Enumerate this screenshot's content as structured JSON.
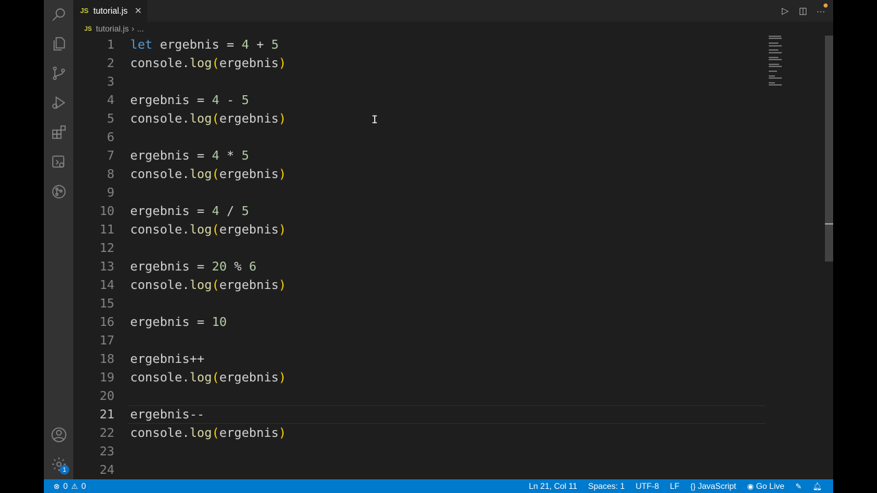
{
  "tab": {
    "label": "tutorial.js",
    "lang_badge": "JS"
  },
  "breadcrumb": {
    "file": "tutorial.js",
    "sep": "›",
    "more": "..."
  },
  "editor": {
    "lines": [
      {
        "n": "1",
        "tokens": [
          [
            "kw",
            "let"
          ],
          [
            "var",
            " ergebnis "
          ],
          [
            "op",
            "= "
          ],
          [
            "num",
            "4"
          ],
          [
            "op",
            " + "
          ],
          [
            "num",
            "5"
          ]
        ]
      },
      {
        "n": "2",
        "tokens": [
          [
            "var",
            "console."
          ],
          [
            "fn",
            "log"
          ],
          [
            "par",
            "("
          ],
          [
            "var",
            "ergebnis"
          ],
          [
            "par",
            ")"
          ]
        ]
      },
      {
        "n": "3",
        "tokens": []
      },
      {
        "n": "4",
        "tokens": [
          [
            "var",
            "ergebnis "
          ],
          [
            "op",
            "= "
          ],
          [
            "num",
            "4"
          ],
          [
            "op",
            " - "
          ],
          [
            "num",
            "5"
          ]
        ]
      },
      {
        "n": "5",
        "tokens": [
          [
            "var",
            "console."
          ],
          [
            "fn",
            "log"
          ],
          [
            "par",
            "("
          ],
          [
            "var",
            "ergebnis"
          ],
          [
            "par",
            ")"
          ]
        ]
      },
      {
        "n": "6",
        "tokens": []
      },
      {
        "n": "7",
        "tokens": [
          [
            "var",
            "ergebnis "
          ],
          [
            "op",
            "= "
          ],
          [
            "num",
            "4"
          ],
          [
            "op",
            " * "
          ],
          [
            "num",
            "5"
          ]
        ]
      },
      {
        "n": "8",
        "tokens": [
          [
            "var",
            "console."
          ],
          [
            "fn",
            "log"
          ],
          [
            "par",
            "("
          ],
          [
            "var",
            "ergebnis"
          ],
          [
            "par",
            ")"
          ]
        ]
      },
      {
        "n": "9",
        "tokens": []
      },
      {
        "n": "10",
        "tokens": [
          [
            "var",
            "ergebnis "
          ],
          [
            "op",
            "= "
          ],
          [
            "num",
            "4"
          ],
          [
            "op",
            " / "
          ],
          [
            "num",
            "5"
          ]
        ]
      },
      {
        "n": "11",
        "tokens": [
          [
            "var",
            "console."
          ],
          [
            "fn",
            "log"
          ],
          [
            "par",
            "("
          ],
          [
            "var",
            "ergebnis"
          ],
          [
            "par",
            ")"
          ]
        ]
      },
      {
        "n": "12",
        "tokens": []
      },
      {
        "n": "13",
        "tokens": [
          [
            "var",
            "ergebnis "
          ],
          [
            "op",
            "= "
          ],
          [
            "num",
            "20"
          ],
          [
            "op",
            " % "
          ],
          [
            "num",
            "6"
          ]
        ]
      },
      {
        "n": "14",
        "tokens": [
          [
            "var",
            "console."
          ],
          [
            "fn",
            "log"
          ],
          [
            "par",
            "("
          ],
          [
            "var",
            "ergebnis"
          ],
          [
            "par",
            ")"
          ]
        ]
      },
      {
        "n": "15",
        "tokens": []
      },
      {
        "n": "16",
        "tokens": [
          [
            "var",
            "ergebnis "
          ],
          [
            "op",
            "= "
          ],
          [
            "num",
            "10"
          ]
        ]
      },
      {
        "n": "17",
        "tokens": []
      },
      {
        "n": "18",
        "tokens": [
          [
            "var",
            "ergebnis++"
          ]
        ]
      },
      {
        "n": "19",
        "tokens": [
          [
            "var",
            "console."
          ],
          [
            "fn",
            "log"
          ],
          [
            "par",
            "("
          ],
          [
            "var",
            "ergebnis"
          ],
          [
            "par",
            ")"
          ]
        ]
      },
      {
        "n": "20",
        "tokens": []
      },
      {
        "n": "21",
        "tokens": [
          [
            "var",
            "ergebnis--"
          ]
        ],
        "current": true
      },
      {
        "n": "22",
        "tokens": [
          [
            "var",
            "console."
          ],
          [
            "fn",
            "log"
          ],
          [
            "par",
            "("
          ],
          [
            "var",
            "ergebnis"
          ],
          [
            "par",
            ")"
          ]
        ]
      },
      {
        "n": "23",
        "tokens": []
      },
      {
        "n": "24",
        "tokens": []
      }
    ]
  },
  "status": {
    "errors": "0",
    "warnings": "0",
    "position": "Ln 21, Col 11",
    "spaces": "Spaces: 1",
    "encoding": "UTF-8",
    "eol": "LF",
    "language": "JavaScript",
    "go_live": "Go Live"
  },
  "badges": {
    "settings_count": "1"
  },
  "colors": {
    "editor_bg": "#1e1e1e",
    "status_bar": "#007acc",
    "keyword": "#569cd6",
    "number": "#b5cea8",
    "function": "#dcdcaa",
    "bracket": "#ffd700"
  }
}
